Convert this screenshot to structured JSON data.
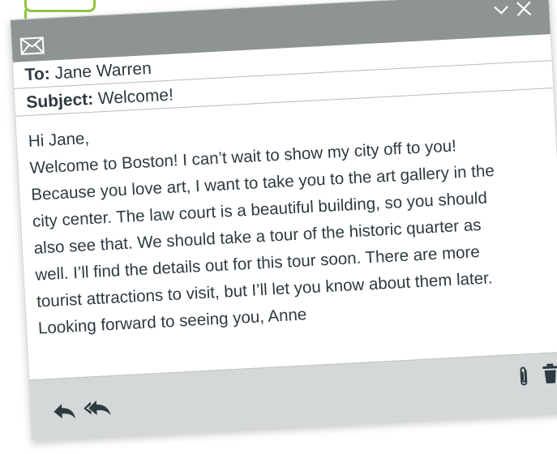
{
  "window": {
    "icons": {
      "mail": "envelope-icon",
      "minimize": "chevron-down-icon",
      "close": "close-icon",
      "reply": "reply-icon",
      "reply_all": "reply-all-icon",
      "attach": "paperclip-icon",
      "delete": "trash-icon"
    }
  },
  "email": {
    "to_label": "To:",
    "to_value": "Jane Warren",
    "subject_label": "Subject:",
    "subject_value": "Welcome!",
    "body_lines": [
      "Hi Jane,",
      "Welcome to Boston! I can’t wait to show my city off to you!",
      "Because you love art, I want to take you to the art gallery in the",
      "city center. The law court is a beautiful building, so you should",
      "also see that. We should take a tour of the historic quarter as",
      "well. I’ll find the details out for this tour soon. There are more",
      "tourist attractions to visit, but I’ll let you know about them later.",
      "Looking forward to seeing you, Anne"
    ]
  },
  "colors": {
    "accent_green": "#8cc63f",
    "titlebar": "#8e9393",
    "bottombar": "#d5d8d8",
    "text": "#2d3a40"
  }
}
